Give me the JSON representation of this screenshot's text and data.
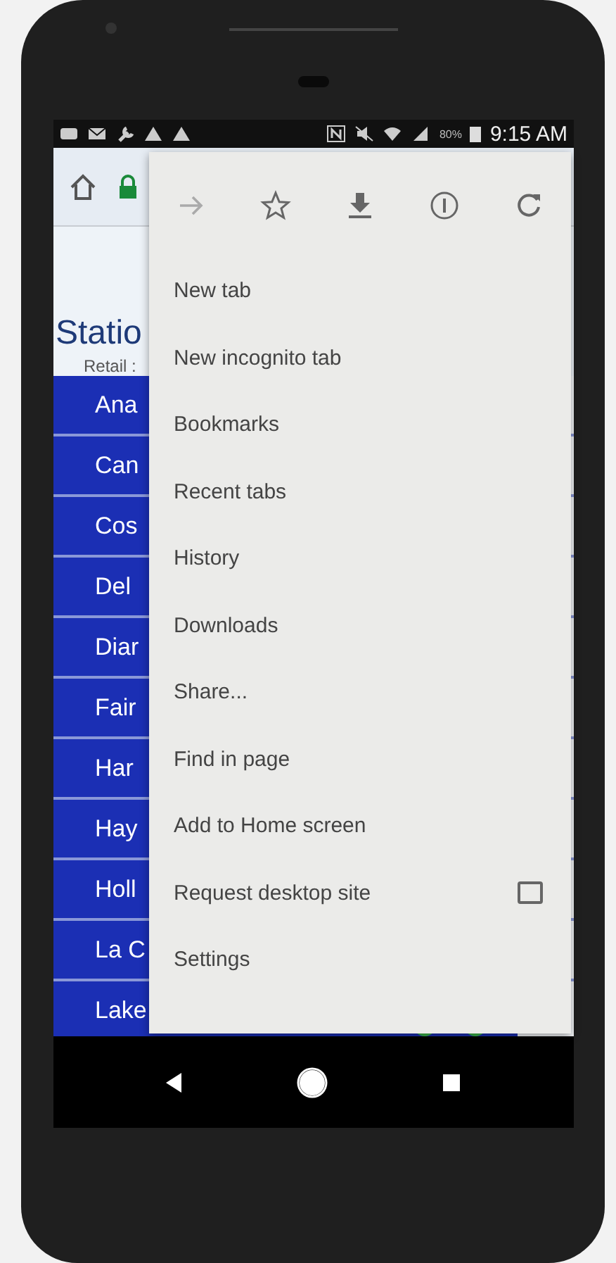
{
  "status_bar": {
    "battery": "80%",
    "time": "9:15 AM"
  },
  "page": {
    "title": "Statio",
    "subtitle": "Retail :",
    "rows": [
      {
        "name": "Ana",
        "kind": "plain"
      },
      {
        "name": "Can",
        "kind": "plain"
      },
      {
        "name": "Cos",
        "kind": "plain"
      },
      {
        "name": "Del",
        "kind": "plain"
      },
      {
        "name": "Diar",
        "kind": "plain"
      },
      {
        "name": "Fair",
        "kind": "plain"
      },
      {
        "name": "Har",
        "kind": "plain"
      },
      {
        "name": "Hay",
        "kind": "plain"
      },
      {
        "name": "Holl",
        "kind": "plain"
      },
      {
        "name": "La C",
        "kind": "plain"
      },
      {
        "name": "Lake",
        "kind": "dots"
      }
    ]
  },
  "menu": {
    "items": [
      {
        "label": "New tab",
        "kind": "plain"
      },
      {
        "label": "New incognito tab",
        "kind": "plain"
      },
      {
        "label": "Bookmarks",
        "kind": "plain"
      },
      {
        "label": "Recent tabs",
        "kind": "plain"
      },
      {
        "label": "History",
        "kind": "plain"
      },
      {
        "label": "Downloads",
        "kind": "plain"
      },
      {
        "label": "Share...",
        "kind": "plain"
      },
      {
        "label": "Find in page",
        "kind": "plain"
      },
      {
        "label": "Add to Home screen",
        "kind": "plain"
      },
      {
        "label": "Request desktop site",
        "kind": "checkbox",
        "checked": false
      },
      {
        "label": "Settings",
        "kind": "plain"
      }
    ]
  }
}
